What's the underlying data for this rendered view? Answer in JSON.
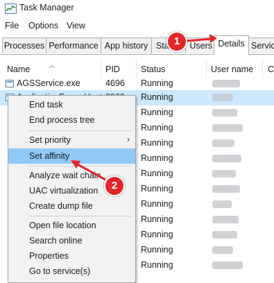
{
  "window": {
    "title": "Task Manager"
  },
  "menu": [
    "File",
    "Options",
    "View"
  ],
  "tabs": [
    {
      "label": "Processes"
    },
    {
      "label": "Performance"
    },
    {
      "label": "App history"
    },
    {
      "label": "Startup"
    },
    {
      "label": "Users"
    },
    {
      "label": "Details",
      "active": true
    },
    {
      "label": "Services"
    }
  ],
  "columns": {
    "name": "Name",
    "pid": "PID",
    "status": "Status",
    "user": "User name",
    "extra": "C"
  },
  "rows": [
    {
      "name": "AGSService.exe",
      "pid": "4696",
      "status": "Running"
    },
    {
      "name": "ApplicationFrameHost.exe",
      "pid": "8960",
      "status": "Running",
      "selected": true
    },
    {
      "name": "",
      "pid": "",
      "status": "Running"
    },
    {
      "name": "",
      "pid": "",
      "status": "Running"
    },
    {
      "name": "",
      "pid": "",
      "status": "Running"
    },
    {
      "name": "",
      "pid": "",
      "status": "Running"
    },
    {
      "name": "",
      "pid": "",
      "status": "Running"
    },
    {
      "name": "",
      "pid": "",
      "status": "Running"
    },
    {
      "name": "",
      "pid": "",
      "status": "Running"
    },
    {
      "name": "",
      "pid": "",
      "status": "Running"
    },
    {
      "name": "",
      "pid": "",
      "status": "Running"
    },
    {
      "name": "",
      "pid": "",
      "status": "Running"
    },
    {
      "name": "",
      "pid": "",
      "status": "Running"
    }
  ],
  "context_menu": {
    "items": [
      {
        "label": "End task"
      },
      {
        "label": "End process tree"
      },
      {
        "label": "Set priority",
        "submenu": "›"
      },
      {
        "label": "Set affinity",
        "highlighted": true
      },
      {
        "label": "Analyze wait chain"
      },
      {
        "label": "UAC virtualization"
      },
      {
        "label": "Create dump file"
      },
      {
        "label": "Open file location"
      },
      {
        "label": "Search online"
      },
      {
        "label": "Properties"
      },
      {
        "label": "Go to service(s)"
      }
    ]
  },
  "annotations": [
    {
      "number": "1"
    },
    {
      "number": "2"
    }
  ],
  "colors": {
    "annotation": "#e3262a",
    "highlight": "#91c9f7",
    "selection": "#cce8ff"
  }
}
